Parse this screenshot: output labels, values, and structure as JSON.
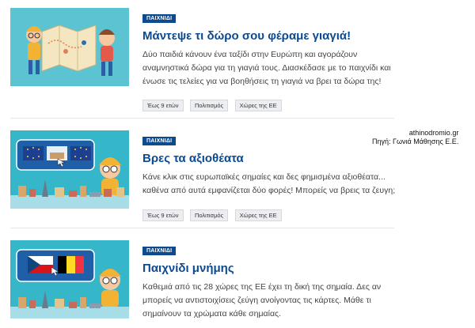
{
  "credit": {
    "line1": "athinodromio.gr",
    "line2": "Πηγή: Γωνιά Μάθησης Ε.Ε."
  },
  "cards": [
    {
      "badge": "ΠΑΙΧΝΙΔΙ",
      "title": "Μάντεψε τι δώρο σου φέραμε γιαγιά!",
      "description": "Δύο παιδιά κάνουν ένα ταξίδι στην Ευρώπη και αγοράζουν αναμνηστικά δώρα για τη γιαγιά τους. Διασκέδασε με το παιχνίδι και ένωσε τις τελείες για να βοηθήσεις τη γιαγιά να βρει τα δώρα της!",
      "tags": [
        "Έως 9 ετών",
        "Πολιτισμός",
        "Χώρες της ΕΕ"
      ]
    },
    {
      "badge": "ΠΑΙΧΝΙΔΙ",
      "title": "Βρες τα αξιοθέατα",
      "description": "Κάνε κλικ στις ευρωπαϊκές σημαίες και δες φημισμένα αξιοθέατα... καθένα από αυτά εμφανίζεται δύο φορές! Μπορείς να βρεις τα ζευγη;",
      "tags": [
        "Έως 9 ετών",
        "Πολιτισμός",
        "Χώρες της ΕΕ"
      ]
    },
    {
      "badge": "ΠΑΙΧΝΙΔΙ",
      "title": "Παιχνίδι μνήμης",
      "description": "Καθεμιά από τις 28 χώρες της ΕΕ έχει τη δική της σημαία. Δες αν μπορείς να αντιστοιχίσεις ζεύγη ανοίγοντας τις κάρτες. Μάθε τι σημαίνουν τα χρώματα κάθε σημαίας.",
      "tags": []
    }
  ]
}
